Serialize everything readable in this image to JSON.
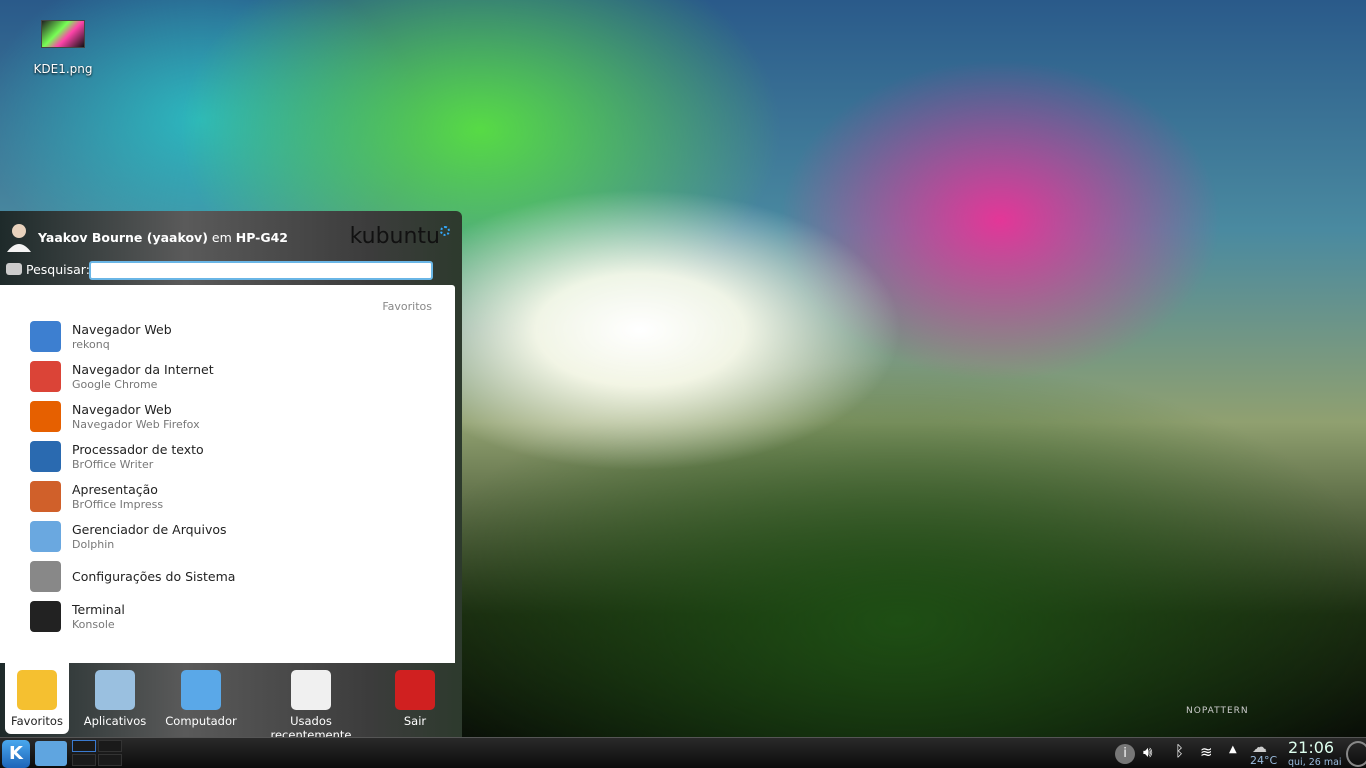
{
  "desktop": {
    "icons": [
      {
        "label": "KDE1.png"
      }
    ],
    "watermark": "NOPATTERN"
  },
  "menu": {
    "user_name": "Yaakov Bourne (yaakov)",
    "user_sep": "em",
    "host": "HP-G42",
    "brand": "kubuntu",
    "search": {
      "label": "Pesquisar:",
      "value": ""
    },
    "section_title": "Favoritos",
    "items": [
      {
        "title": "Navegador Web",
        "subtitle": "rekonq",
        "icon": "rekonq-icon",
        "color": "#3d7fd0"
      },
      {
        "title": "Navegador da Internet",
        "subtitle": "Google Chrome",
        "icon": "chrome-icon",
        "color": "#db4437"
      },
      {
        "title": "Navegador Web",
        "subtitle": "Navegador Web Firefox",
        "icon": "firefox-icon",
        "color": "#e66000"
      },
      {
        "title": "Processador de texto",
        "subtitle": "BrOffice Writer",
        "icon": "writer-icon",
        "color": "#2a6ab0"
      },
      {
        "title": "Apresentação",
        "subtitle": "BrOffice Impress",
        "icon": "impress-icon",
        "color": "#d0602a"
      },
      {
        "title": "Gerenciador de Arquivos",
        "subtitle": "Dolphin",
        "icon": "dolphin-icon",
        "color": "#6aa8e0"
      },
      {
        "title": "Configurações do Sistema",
        "subtitle": "",
        "icon": "settings-icon",
        "color": "#888888"
      },
      {
        "title": "Terminal",
        "subtitle": "Konsole",
        "icon": "terminal-icon",
        "color": "#222222"
      }
    ],
    "tabs": [
      {
        "label": "Favoritos",
        "icon": "star-icon",
        "active": true
      },
      {
        "label": "Aplicativos",
        "icon": "applications-icon"
      },
      {
        "label": "Computador",
        "icon": "computer-icon"
      },
      {
        "label": "Usados recentemente",
        "icon": "recent-icon"
      },
      {
        "label": "Sair",
        "icon": "power-icon"
      }
    ]
  },
  "tray": {
    "temperature": "24°C",
    "time": "21:06",
    "date": "qui, 26 mai"
  }
}
